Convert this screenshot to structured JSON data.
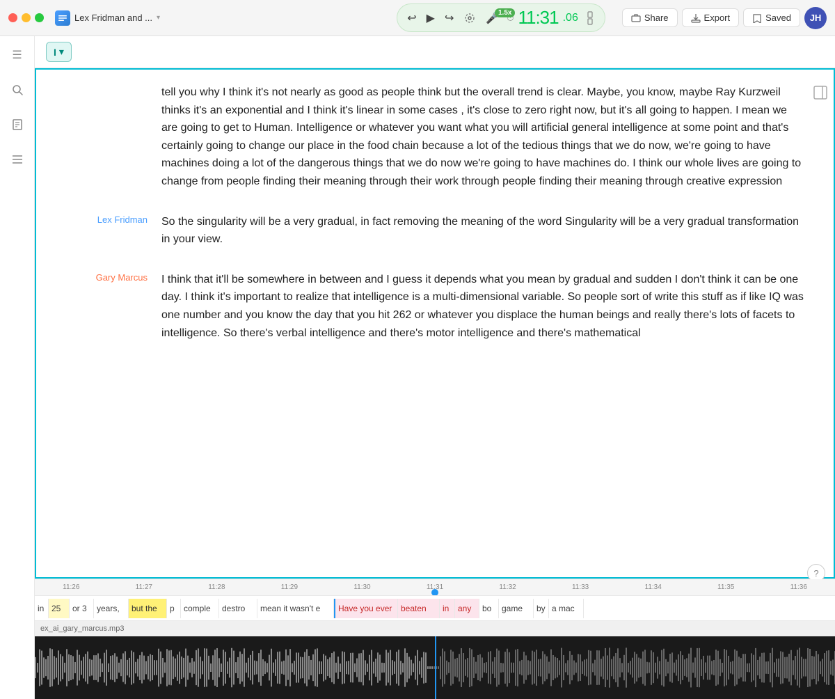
{
  "titlebar": {
    "app_title": "Lex Fridman and ...",
    "chevron": "▾",
    "speed": "1.5x",
    "timer": "11:31",
    "timer_decimal": ".06",
    "share_label": "Share",
    "export_label": "Export",
    "saved_label": "Saved",
    "avatar_initials": "JH"
  },
  "sidebar": {
    "icons": [
      {
        "name": "hamburger-menu-icon",
        "symbol": "☰"
      },
      {
        "name": "search-icon",
        "symbol": "🔍"
      },
      {
        "name": "document-icon",
        "symbol": "📄"
      },
      {
        "name": "library-icon",
        "symbol": "≡"
      }
    ]
  },
  "transcript": {
    "toolbar": {
      "cursor_label": "I",
      "cursor_arrow": "▾"
    },
    "blocks": [
      {
        "speaker": "",
        "speaker_class": "",
        "text": "tell you why I think it's not nearly as good as people think but the overall trend is clear. Maybe, you know, maybe Ray Kurzweil thinks it's an exponential and I think it's linear in some cases , it's close to zero right now, but it's all going to happen. I mean we are going to get to Human. Intelligence or whatever you want what you will artificial general intelligence at some point and that's certainly going to change our place in the food chain because a lot of the tedious things that we do now, we're going to have machines doing a lot of the dangerous things that we do now we're going to have machines do. I think our whole lives are going to change from people finding their meaning through their work through people finding their meaning through creative expression"
      },
      {
        "speaker": "Lex Fridman",
        "speaker_class": "speaker-lex",
        "text": "So the singularity will be a very gradual, in fact removing the meaning of the word Singularity will be a very gradual transformation in your view."
      },
      {
        "speaker": "Gary Marcus",
        "speaker_class": "speaker-gary",
        "text": "I think that it'll be somewhere in between and I guess it depends what you mean by gradual and sudden I don't think it can be one day. I think it's important to realize that intelligence is a multi-dimensional variable. So people sort of write this stuff as if like IQ was one number and you know the day that you hit 262 or whatever you displace the human beings and really there's lots of facets to intelligence. So there's verbal intelligence and there's motor intelligence and there's mathematical"
      }
    ]
  },
  "timeline": {
    "ruler_marks": [
      "11:26",
      "11:27",
      "11:28",
      "11:29",
      "11:30",
      "11:31",
      "11:32",
      "11:33",
      "11:34",
      "11:35",
      "11:36"
    ],
    "tokens": [
      {
        "text": "in",
        "type": "normal"
      },
      {
        "text": "25",
        "type": "normal"
      },
      {
        "text": "or 3",
        "type": "normal"
      },
      {
        "text": "years,",
        "type": "normal"
      },
      {
        "text": "but the",
        "type": "highlighted"
      },
      {
        "text": "p",
        "type": "normal"
      },
      {
        "text": "comple",
        "type": "normal"
      },
      {
        "text": "destro",
        "type": "normal"
      },
      {
        "text": "mean it wasn't e",
        "type": "normal"
      },
      {
        "text": "Have you ever",
        "type": "active-pink"
      },
      {
        "text": "beaten",
        "type": "active-pink"
      },
      {
        "text": "in",
        "type": "active-pink"
      },
      {
        "text": "any",
        "type": "active-pink"
      },
      {
        "text": "bo",
        "type": "normal"
      },
      {
        "text": "game",
        "type": "normal"
      },
      {
        "text": "by",
        "type": "normal"
      },
      {
        "text": "a mac",
        "type": "normal"
      }
    ],
    "filename": "ex_ai_gary_marcus.mp3"
  }
}
